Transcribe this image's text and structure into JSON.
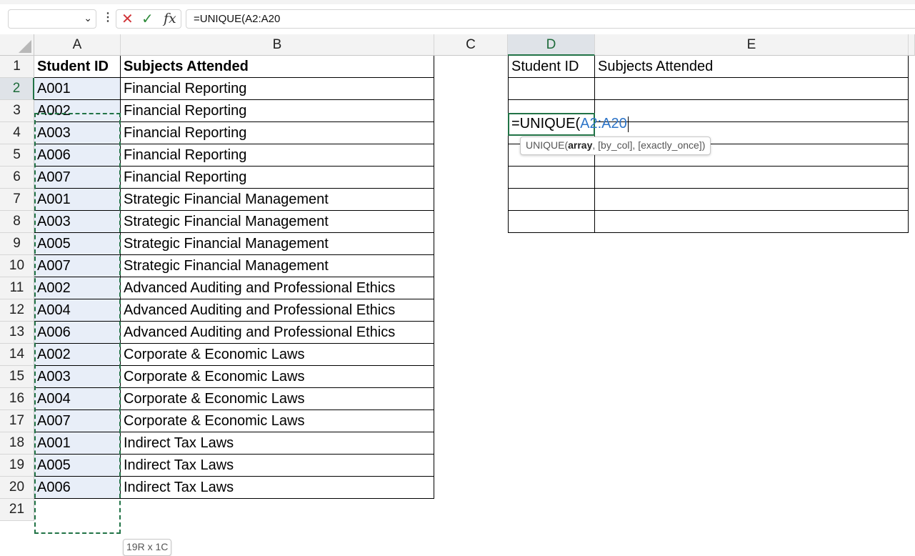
{
  "formula_bar": {
    "name_box": "",
    "formula": "=UNIQUE(A2:A20",
    "fx_label": "fx",
    "cancel_glyph": "✕",
    "enter_glyph": "✓",
    "dots": "⋮"
  },
  "columns": [
    "A",
    "B",
    "C",
    "D",
    "E"
  ],
  "rows": [
    "1",
    "2",
    "3",
    "4",
    "5",
    "6",
    "7",
    "8",
    "9",
    "10",
    "11",
    "12",
    "13",
    "14",
    "15",
    "16",
    "17",
    "18",
    "19",
    "20",
    "21"
  ],
  "table": {
    "headers": [
      "Student ID",
      "Subjects Attended"
    ],
    "data": [
      [
        "A001",
        "Financial Reporting"
      ],
      [
        "A002",
        "Financial Reporting"
      ],
      [
        "A003",
        "Financial Reporting"
      ],
      [
        "A006",
        "Financial Reporting"
      ],
      [
        "A007",
        "Financial Reporting"
      ],
      [
        "A001",
        "Strategic Financial Management"
      ],
      [
        "A003",
        "Strategic Financial Management"
      ],
      [
        "A005",
        "Strategic Financial Management"
      ],
      [
        "A007",
        "Strategic Financial Management"
      ],
      [
        "A002",
        "Advanced Auditing and Professional Ethics"
      ],
      [
        "A004",
        "Advanced Auditing and Professional Ethics"
      ],
      [
        "A006",
        "Advanced Auditing and Professional Ethics"
      ],
      [
        "A002",
        "Corporate & Economic Laws"
      ],
      [
        "A003",
        "Corporate & Economic Laws"
      ],
      [
        "A004",
        "Corporate & Economic Laws"
      ],
      [
        "A007",
        "Corporate & Economic Laws"
      ],
      [
        "A001",
        "Indirect Tax Laws"
      ],
      [
        "A005",
        "Indirect Tax Laws"
      ],
      [
        "A006",
        "Indirect Tax Laws"
      ]
    ]
  },
  "result_table": {
    "headers": [
      "Student ID",
      "Subjects Attended"
    ],
    "editing_cell": {
      "prefix": "=UNIQUE(",
      "range": "A2:A20"
    }
  },
  "tooltip": {
    "func": "UNIQUE(",
    "arg1": "array",
    "rest": ", [by_col], [exactly_once])"
  },
  "size_tip": "19R x 1C",
  "colors": {
    "accent": "#217346",
    "ref_blue": "#2e75c8",
    "selection": "#e8eef8"
  }
}
